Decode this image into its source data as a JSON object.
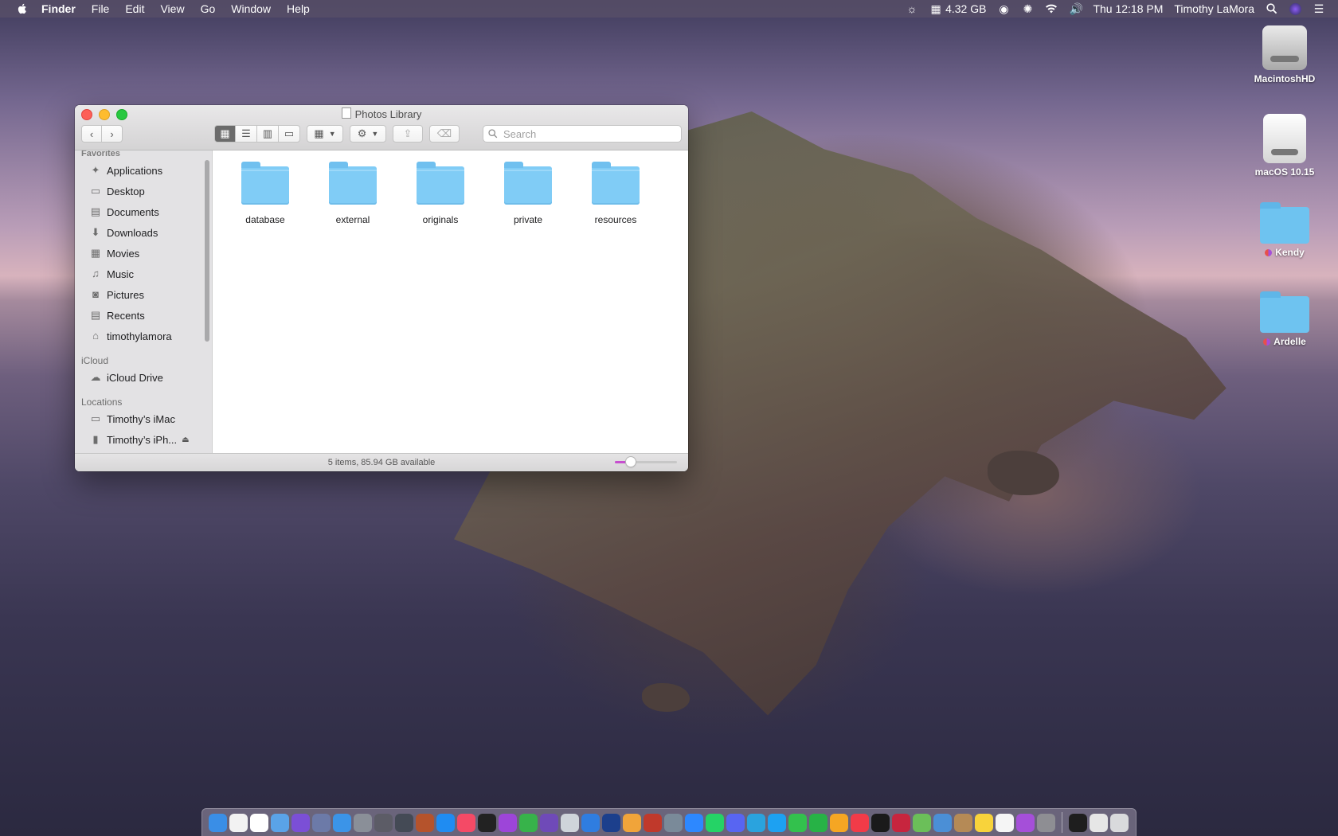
{
  "menubar": {
    "app_name": "Finder",
    "menus": [
      "File",
      "Edit",
      "View",
      "Go",
      "Window",
      "Help"
    ],
    "memory": "4.32 GB",
    "clock": "Thu 12:18 PM",
    "user": "Timothy LaMora"
  },
  "desktop": {
    "icons": [
      {
        "label": "MacintoshHD"
      },
      {
        "label": "macOS 10.15"
      },
      {
        "label": "Kendy"
      },
      {
        "label": "Ardelle"
      }
    ]
  },
  "window": {
    "title": "Photos Library",
    "search_placeholder": "Search",
    "status": "5 items, 85.94 GB available",
    "icon_size_fraction": 0.25
  },
  "sidebar": {
    "sections": [
      {
        "title": "Favorites",
        "items": [
          "Applications",
          "Desktop",
          "Documents",
          "Downloads",
          "Movies",
          "Music",
          "Pictures",
          "Recents",
          "timothylamora"
        ]
      },
      {
        "title": "iCloud",
        "items": [
          "iCloud Drive"
        ]
      },
      {
        "title": "Locations",
        "items": [
          "Timothy’s iMac",
          "Timothy’s iPh..."
        ]
      }
    ]
  },
  "content": {
    "folders": [
      "database",
      "external",
      "originals",
      "private",
      "resources"
    ]
  },
  "dock": {
    "apps": [
      {
        "name": "finder-icon",
        "color": "#3a8ee6"
      },
      {
        "name": "clock-icon",
        "color": "#f2f2f2"
      },
      {
        "name": "calendar-icon",
        "color": "#ffffff"
      },
      {
        "name": "mail-icon",
        "color": "#5aa3e8"
      },
      {
        "name": "siri-icon",
        "color": "#7b4fd6"
      },
      {
        "name": "launchpad-icon",
        "color": "#6c7aa8"
      },
      {
        "name": "safari-icon",
        "color": "#3b94e8"
      },
      {
        "name": "rocket-icon",
        "color": "#8a8f98"
      },
      {
        "name": "disk-utility-icon",
        "color": "#5c5c66"
      },
      {
        "name": "camera-icon",
        "color": "#444a55"
      },
      {
        "name": "planet-icon",
        "color": "#b5532c"
      },
      {
        "name": "app-store-icon",
        "color": "#1f8cf2"
      },
      {
        "name": "music-icon",
        "color": "#f44a66"
      },
      {
        "name": "tv-icon",
        "color": "#222222"
      },
      {
        "name": "podcasts-icon",
        "color": "#9d45d9"
      },
      {
        "name": "find-my-icon",
        "color": "#37b34a"
      },
      {
        "name": "imovie-icon",
        "color": "#6f4ab8"
      },
      {
        "name": "preview-icon",
        "color": "#cfd4da"
      },
      {
        "name": "chrome-icon",
        "color": "#2f7de0"
      },
      {
        "name": "quicktime-icon",
        "color": "#1c3f8c"
      },
      {
        "name": "photos-icon",
        "color": "#f0a43a"
      },
      {
        "name": "photo-booth-icon",
        "color": "#c0392b"
      },
      {
        "name": "image-capture-icon",
        "color": "#7a8a99"
      },
      {
        "name": "messenger-icon",
        "color": "#2d88ff"
      },
      {
        "name": "whatsapp-icon",
        "color": "#25d366"
      },
      {
        "name": "discord-icon",
        "color": "#5865f2"
      },
      {
        "name": "telegram-icon",
        "color": "#2aa3de"
      },
      {
        "name": "twitter-icon",
        "color": "#1da1f2"
      },
      {
        "name": "messages-icon",
        "color": "#33c14d"
      },
      {
        "name": "facetime-icon",
        "color": "#27b246"
      },
      {
        "name": "home-icon",
        "color": "#f5a623"
      },
      {
        "name": "news-icon",
        "color": "#f23b48"
      },
      {
        "name": "stocks-icon",
        "color": "#1a1a1a"
      },
      {
        "name": "photo-slideshow-icon",
        "color": "#c7253e"
      },
      {
        "name": "maps-icon",
        "color": "#6bbf59"
      },
      {
        "name": "preview-icon",
        "color": "#4b8fd6"
      },
      {
        "name": "contacts-icon",
        "color": "#b58a56"
      },
      {
        "name": "notes-icon",
        "color": "#f8d33b"
      },
      {
        "name": "reminders-icon",
        "color": "#f5f5f5"
      },
      {
        "name": "feedback-icon",
        "color": "#a54fd9"
      },
      {
        "name": "system-preferences-icon",
        "color": "#8e8e93"
      },
      {
        "name": "terminal-icon",
        "color": "#1e1e1e"
      },
      {
        "name": "documents-stack-icon",
        "color": "#e6e6e6"
      },
      {
        "name": "trash-icon",
        "color": "#d9dadc"
      }
    ]
  }
}
